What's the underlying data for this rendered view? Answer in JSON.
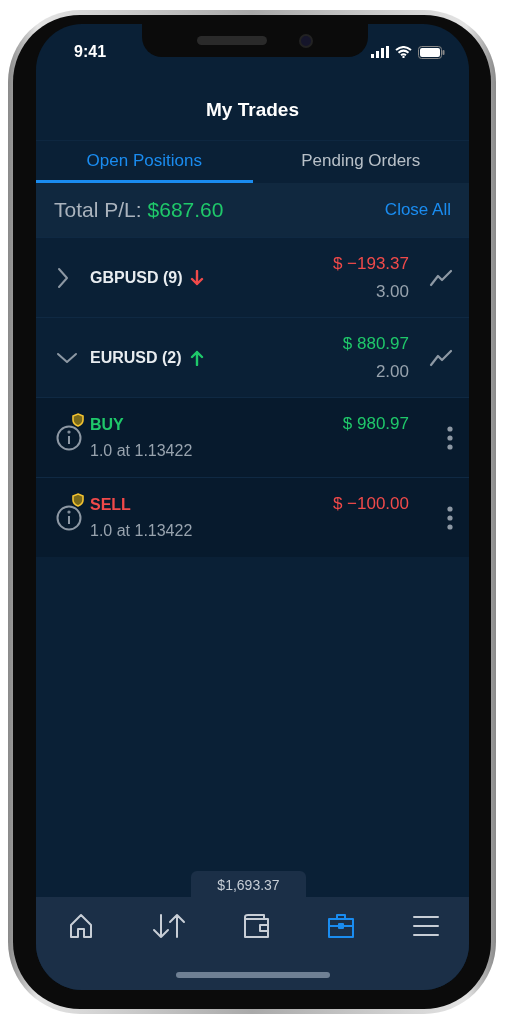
{
  "status_bar": {
    "time": "9:41"
  },
  "header": {
    "title": "My Trades"
  },
  "tabs": [
    {
      "label": "Open Positions",
      "selected": true
    },
    {
      "label": "Pending Orders",
      "selected": false
    }
  ],
  "summary": {
    "label": "Total P/L:",
    "value": "$687.60",
    "negative": false,
    "action": "Close All"
  },
  "positions": [
    {
      "symbol": "GBPUSD (9)",
      "expanded": false,
      "rising": false,
      "pl": "$ −193.37",
      "negative": true,
      "volume": "3.00"
    },
    {
      "symbol": "EURUSD (2)",
      "expanded": true,
      "rising": true,
      "pl": "$ 880.97",
      "negative": false,
      "volume": "2.00",
      "children": [
        {
          "side": "BUY",
          "kind": "buy",
          "detail": "1.0 at 1.13422",
          "pl": "$ 980.97",
          "negative": false
        },
        {
          "side": "SELL",
          "kind": "sell",
          "detail": "1.0 at 1.13422",
          "pl": "$ −100.00",
          "negative": true
        }
      ]
    }
  ],
  "balance": "$1,693.37",
  "nav": [
    {
      "kind": "home",
      "selected": false
    },
    {
      "kind": "transfer",
      "selected": false
    },
    {
      "kind": "wallet",
      "selected": false
    },
    {
      "kind": "portfolio",
      "selected": true
    },
    {
      "kind": "menu",
      "selected": false
    }
  ]
}
